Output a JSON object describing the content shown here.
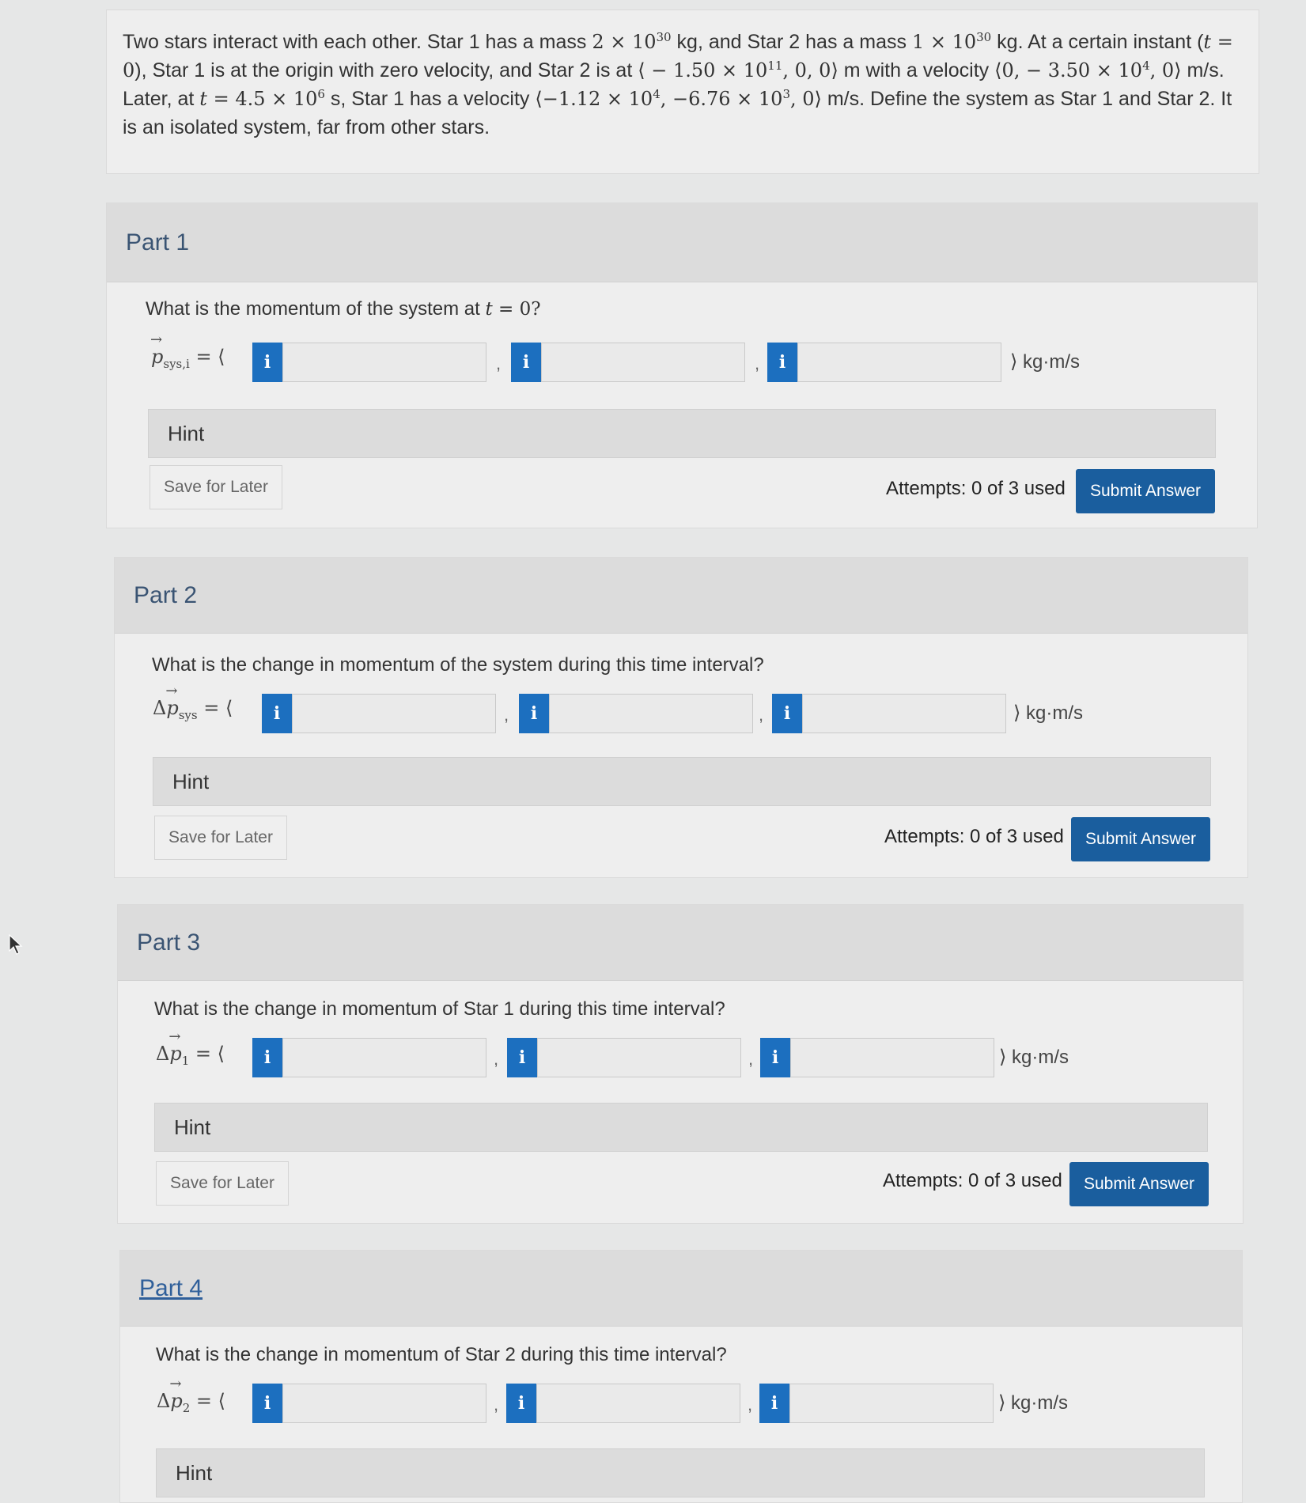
{
  "problem": {
    "intro": "Two stars interact with each other. Star 1 has a mass ",
    "mass1_mantissa": "2 × 10",
    "mass1_exp": "30",
    "after_mass1": " kg, and Star 2 has a mass ",
    "mass2_mantissa": "1 × 10",
    "mass2_exp": "30",
    "after_mass2": " kg. At a certain instant (",
    "t_var": "t",
    "t_eq0": " = 0",
    "after_t0": "), Star 1 is at the origin with zero velocity, and Star 2 is at ",
    "pos_open": "⟨ − 1.50 × 10",
    "pos_exp": "11",
    "pos_close": ", 0, 0⟩",
    "after_pos": " m with a velocity ",
    "vel_open": "⟨0,  − 3.50 × 10",
    "vel_exp": "4",
    "vel_close": ", 0⟩",
    "after_vel": " m/s. Later, at ",
    "t_var2": "t",
    "t_eq2": " = 4.5 × 10",
    "t_exp2": "6",
    "after_t2": " s, Star 1 has a velocity ",
    "v1_open": "⟨−1.12 × 10",
    "v1_exp1": "4",
    "v1_mid": ", −6.76 × 10",
    "v1_exp2": "3",
    "v1_close": ", 0⟩",
    "after_v1": " m/s. Define the system as Star 1 and Star 2. It is an isolated system, far from other stars."
  },
  "parts": [
    {
      "title": "Part 1",
      "question_pre": "What is the momentum of the system at ",
      "question_var": "t",
      "question_post": " = 0?",
      "lhs_sym": "p",
      "lhs_sub": "sys,i",
      "lhs_eq": " = ⟨",
      "unit": "⟩ kg·m/s",
      "values": [
        "",
        "",
        ""
      ],
      "hint": "Hint",
      "save": "Save for Later",
      "attempts": "Attempts: 0 of 3 used",
      "submit": "Submit Answer"
    },
    {
      "title": "Part 2",
      "question_pre": "What is the change in momentum of the system during this time interval?",
      "lhs_delta": "Δ",
      "lhs_sym": "p",
      "lhs_sub": "sys",
      "lhs_eq": " = ⟨",
      "unit": "⟩ kg·m/s",
      "values": [
        "",
        "",
        ""
      ],
      "hint": "Hint",
      "save": "Save for Later",
      "attempts": "Attempts: 0 of 3 used",
      "submit": "Submit Answer"
    },
    {
      "title": "Part 3",
      "question_pre": "What is the change in momentum of Star 1 during this time interval?",
      "lhs_delta": "Δ",
      "lhs_sym": "p",
      "lhs_sub": "1",
      "lhs_eq": " = ⟨",
      "unit": "⟩ kg·m/s",
      "values": [
        "",
        "",
        ""
      ],
      "hint": "Hint",
      "save": "Save for Later",
      "attempts": "Attempts: 0 of 3 used",
      "submit": "Submit Answer"
    },
    {
      "title": "Part 4",
      "question_pre": "What is the change in momentum of Star 2 during this time interval?",
      "lhs_delta": "Δ",
      "lhs_sym": "p",
      "lhs_sub": "2",
      "lhs_eq": " = ⟨",
      "unit": "⟩ kg·m/s",
      "values": [
        "",
        "",
        ""
      ],
      "hint": "Hint"
    }
  ],
  "info_icon": "i",
  "separator": ",",
  "colors": {
    "accent": "#1a5e9e",
    "info": "#1c6fbf",
    "panel": "#eeeeee",
    "header": "#dcdcdc"
  }
}
